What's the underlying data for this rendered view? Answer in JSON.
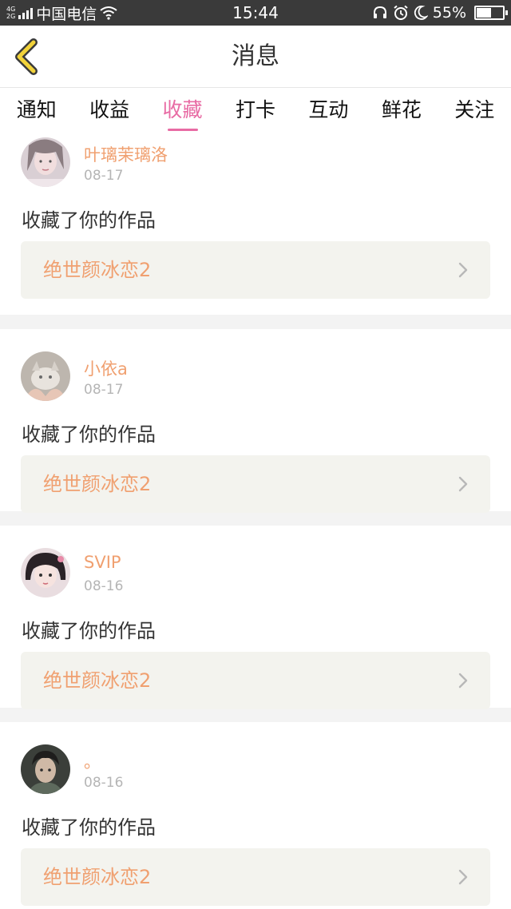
{
  "status_bar": {
    "net_top": "4G",
    "net_bottom": "2G",
    "carrier": "中国电信",
    "time": "15:44",
    "battery_text": "55%",
    "battery_level": 0.55
  },
  "header": {
    "title": "消息"
  },
  "tabs": [
    {
      "label": "通知",
      "active": false
    },
    {
      "label": "收益",
      "active": false
    },
    {
      "label": "收藏",
      "active": true
    },
    {
      "label": "打卡",
      "active": false
    },
    {
      "label": "互动",
      "active": false
    },
    {
      "label": "鲜花",
      "active": false
    },
    {
      "label": "关注",
      "active": false
    }
  ],
  "feed": [
    {
      "user": "叶璃茉璃洛",
      "date": "08-17",
      "action": "收藏了你的作品",
      "work": "绝世颜冰恋2"
    },
    {
      "user": "小依a",
      "date": "08-17",
      "action": "收藏了你的作品",
      "work": "绝世颜冰恋2"
    },
    {
      "user": "SVIP",
      "date": "08-16",
      "action": "收藏了你的作品",
      "work": "绝世颜冰恋2"
    },
    {
      "user": "。",
      "date": "08-16",
      "action": "收藏了你的作品",
      "work": "绝世颜冰恋2"
    }
  ],
  "colors": {
    "accent_pink": "#e86ba4",
    "name_orange": "#f0a070",
    "back_icon_yellow": "#f2d33a"
  },
  "icons": [
    "back-arrow-icon",
    "wifi-icon",
    "headset-icon",
    "alarm-icon",
    "moon-icon",
    "battery-icon",
    "chevron-right-icon"
  ]
}
